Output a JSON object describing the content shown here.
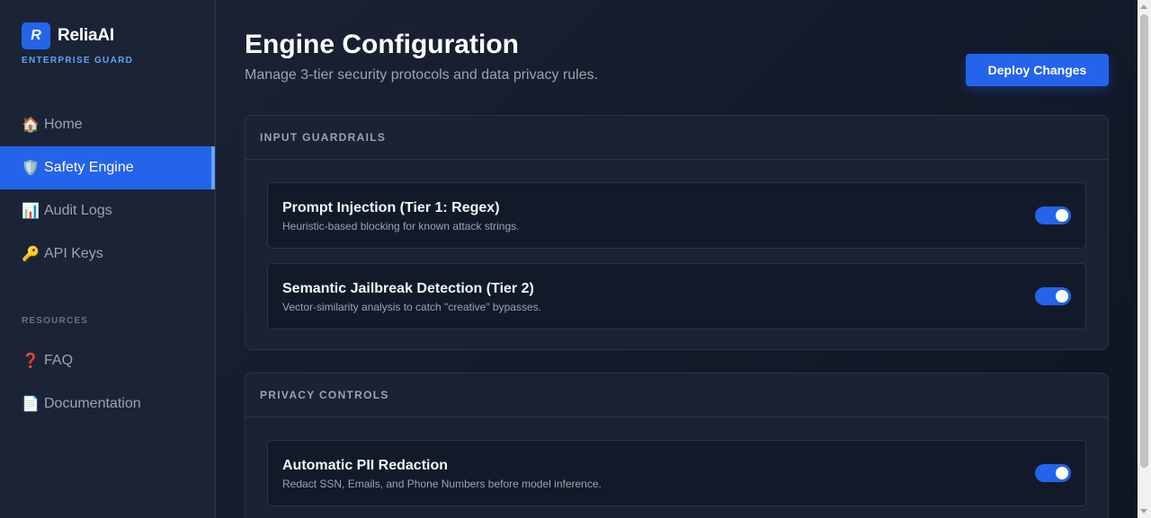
{
  "brand": {
    "logo_letter": "R",
    "name": "ReliaAI",
    "tagline": "ENTERPRISE GUARD"
  },
  "nav": {
    "items": [
      {
        "icon": "🏠",
        "icon_name": "home-icon",
        "label": "Home",
        "active": false
      },
      {
        "icon": "🛡️",
        "icon_name": "shield-icon",
        "label": "Safety Engine",
        "active": true
      },
      {
        "icon": "📊",
        "icon_name": "bar-chart-icon",
        "label": "Audit Logs",
        "active": false
      },
      {
        "icon": "🔑",
        "icon_name": "key-icon",
        "label": "API Keys",
        "active": false
      }
    ],
    "resources_label": "RESOURCES",
    "resources": [
      {
        "icon": "❓",
        "icon_name": "question-icon",
        "label": "FAQ"
      },
      {
        "icon": "📄",
        "icon_name": "document-icon",
        "label": "Documentation"
      }
    ]
  },
  "header": {
    "title": "Engine Configuration",
    "subtitle": "Manage 3-tier security protocols and data privacy rules.",
    "deploy_label": "Deploy Changes"
  },
  "sections": [
    {
      "title": "INPUT GUARDRAILS",
      "rules": [
        {
          "title": "Prompt Injection (Tier 1: Regex)",
          "description": "Heuristic-based blocking for known attack strings.",
          "enabled": true
        },
        {
          "title": "Semantic Jailbreak Detection (Tier 2)",
          "description": "Vector-similarity analysis to catch \"creative\" bypasses.",
          "enabled": true
        }
      ]
    },
    {
      "title": "PRIVACY CONTROLS",
      "rules": [
        {
          "title": "Automatic PII Redaction",
          "description": "Redact SSN, Emails, and Phone Numbers before model inference.",
          "enabled": true
        }
      ]
    }
  ],
  "colors": {
    "accent": "#2563eb",
    "accent_light": "#60a5fa",
    "sidebar_bg": "#1b2436",
    "main_bg": "#131a29"
  }
}
